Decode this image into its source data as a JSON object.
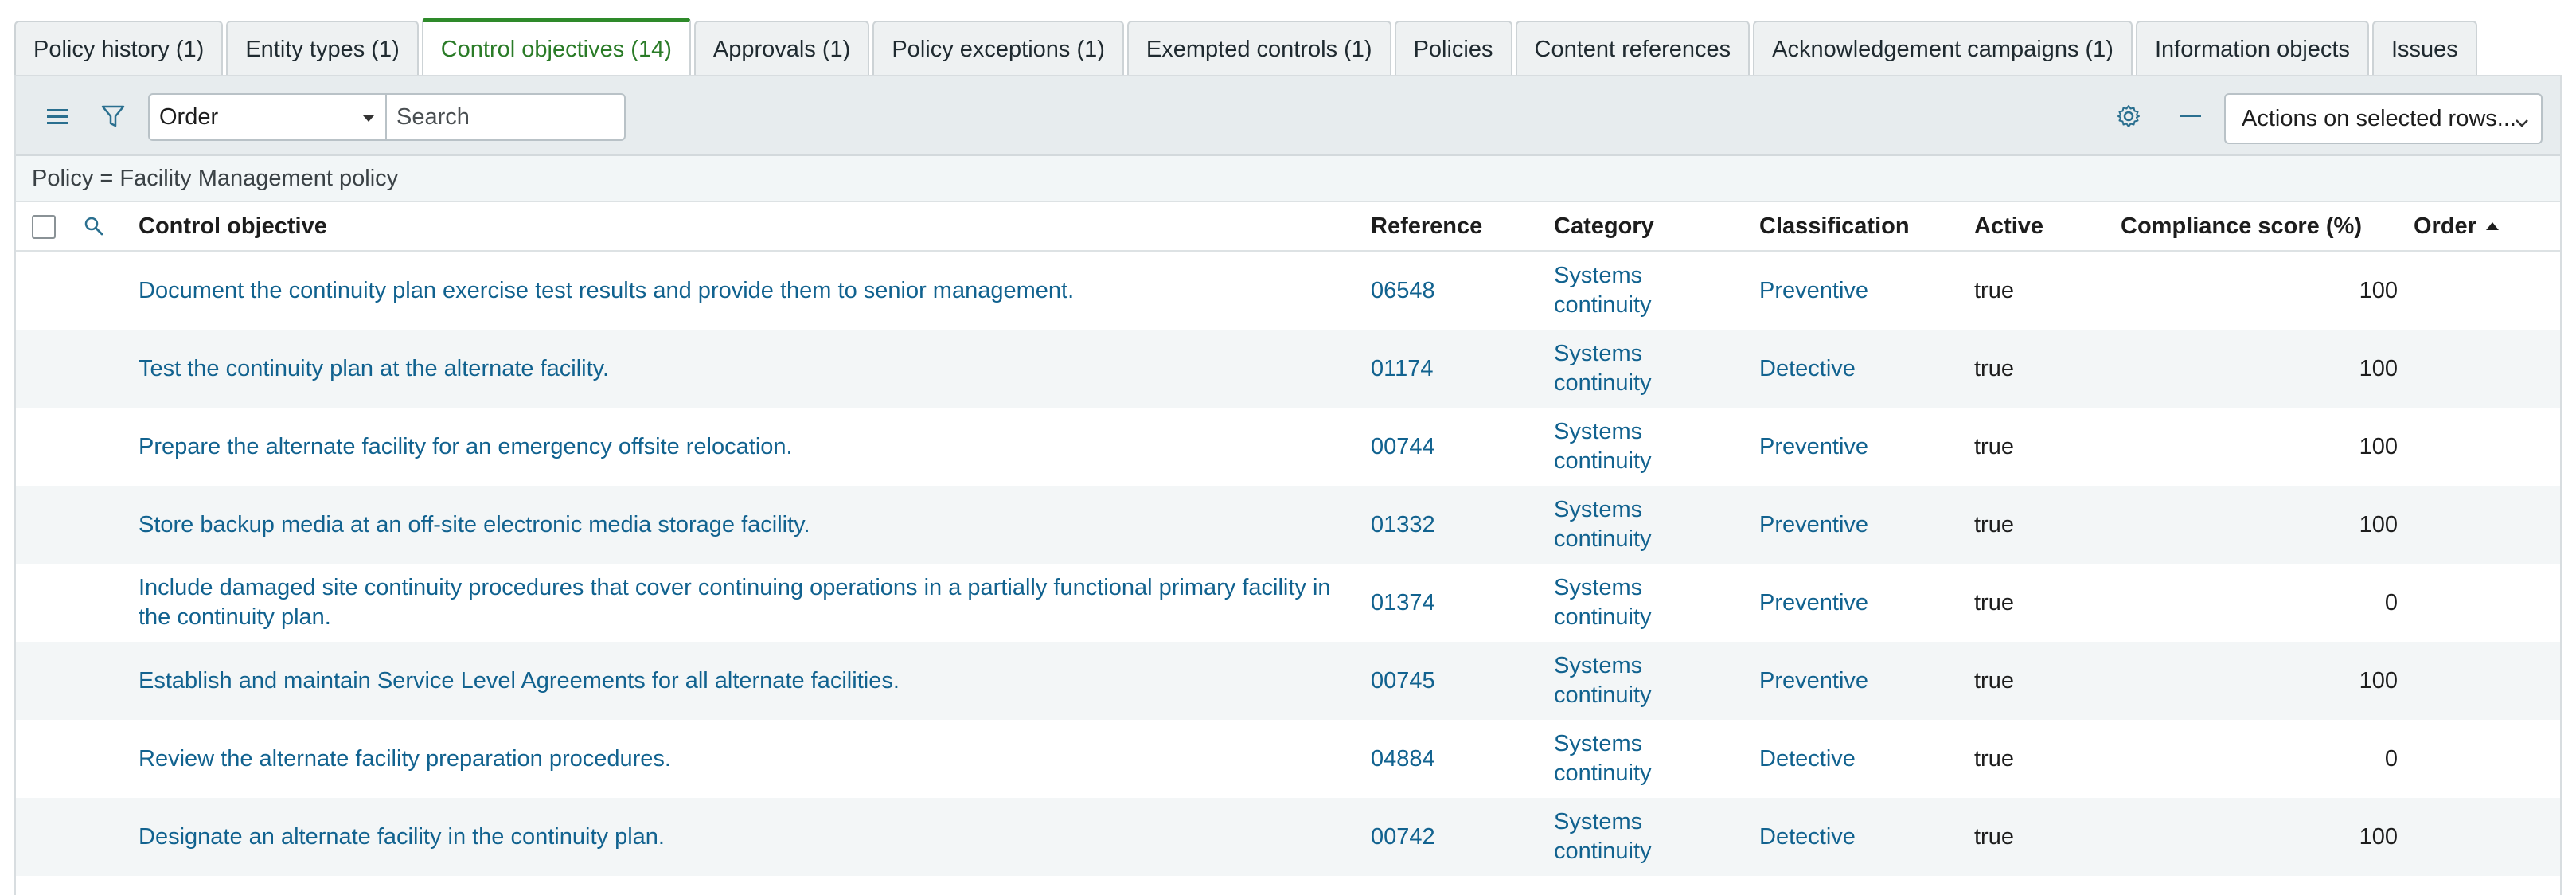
{
  "tabs": [
    {
      "label": "Policy history (1)"
    },
    {
      "label": "Entity types (1)"
    },
    {
      "label": "Control objectives (14)"
    },
    {
      "label": "Approvals (1)"
    },
    {
      "label": "Policy exceptions (1)"
    },
    {
      "label": "Exempted controls (1)"
    },
    {
      "label": "Policies"
    },
    {
      "label": "Content references"
    },
    {
      "label": "Acknowledgement campaigns (1)"
    },
    {
      "label": "Information objects"
    },
    {
      "label": "Issues"
    }
  ],
  "active_tab": "Control objectives (14)",
  "toolbar": {
    "field_select_value": "Order",
    "search_placeholder": "Search",
    "actions_label": "Actions on selected rows..."
  },
  "filter": "Policy = Facility Management policy",
  "columns": {
    "control_objective": "Control objective",
    "reference": "Reference",
    "category": "Category",
    "classification": "Classification",
    "active": "Active",
    "compliance_score": "Compliance score (%)",
    "order": "Order"
  },
  "rows": [
    {
      "objective": "Document the continuity plan exercise test results and provide them to senior management.",
      "reference": "06548",
      "category": "Systems continuity",
      "classification": "Preventive",
      "active": "true",
      "score": "100",
      "order": ""
    },
    {
      "objective": "Test the continuity plan at the alternate facility.",
      "reference": "01174",
      "category": "Systems continuity",
      "classification": "Detective",
      "active": "true",
      "score": "100",
      "order": ""
    },
    {
      "objective": "Prepare the alternate facility for an emergency offsite relocation.",
      "reference": "00744",
      "category": "Systems continuity",
      "classification": "Preventive",
      "active": "true",
      "score": "100",
      "order": ""
    },
    {
      "objective": "Store backup media at an off-site electronic media storage facility.",
      "reference": "01332",
      "category": "Systems continuity",
      "classification": "Preventive",
      "active": "true",
      "score": "100",
      "order": ""
    },
    {
      "objective": "Include damaged site continuity procedures that cover continuing operations in a partially functional primary facility in the continuity plan.",
      "reference": "01374",
      "category": "Systems continuity",
      "classification": "Preventive",
      "active": "true",
      "score": "0",
      "order": ""
    },
    {
      "objective": "Establish and maintain Service Level Agreements for all alternate facilities.",
      "reference": "00745",
      "category": "Systems continuity",
      "classification": "Preventive",
      "active": "true",
      "score": "100",
      "order": ""
    },
    {
      "objective": "Review the alternate facility preparation procedures.",
      "reference": "04884",
      "category": "Systems continuity",
      "classification": "Detective",
      "active": "true",
      "score": "0",
      "order": ""
    },
    {
      "objective": "Designate an alternate facility in the continuity plan.",
      "reference": "00742",
      "category": "Systems continuity",
      "classification": "Detective",
      "active": "true",
      "score": "100",
      "order": ""
    }
  ],
  "colors": {
    "link": "#11628f",
    "active_tab": "#2a7b27",
    "toolbar_bg": "#e7ecee",
    "alt_row": "#f3f6f7"
  }
}
